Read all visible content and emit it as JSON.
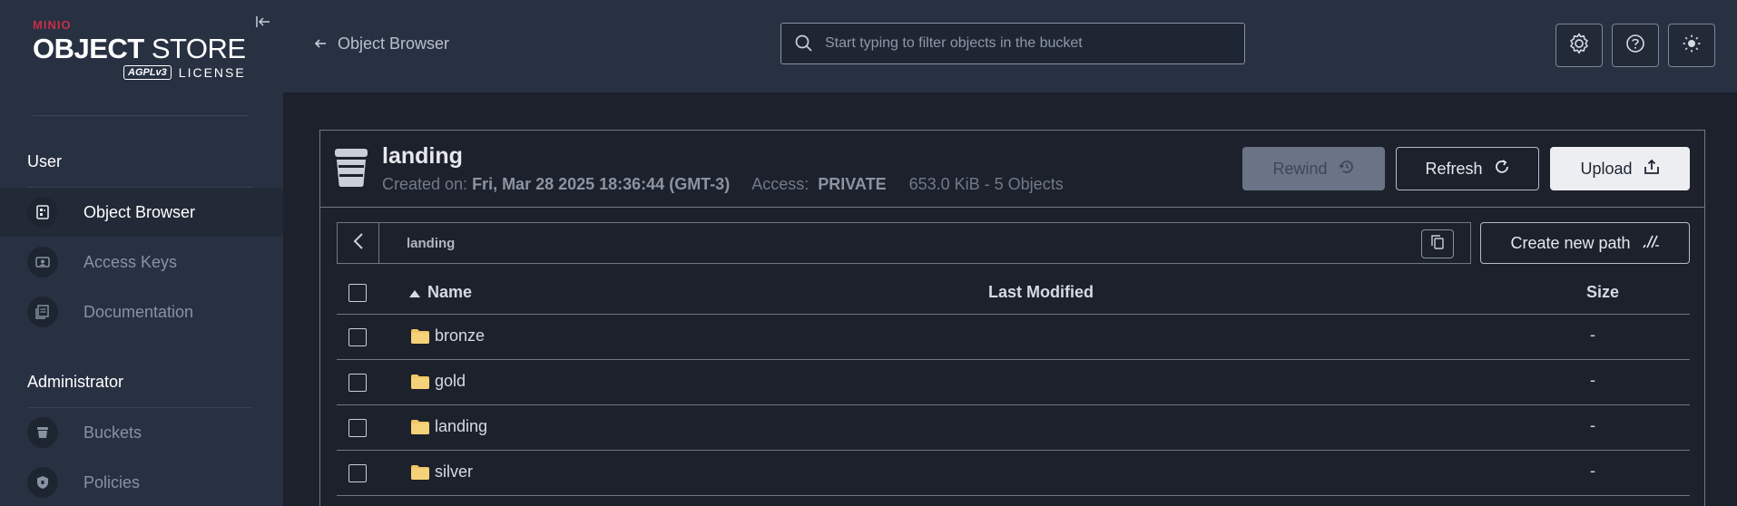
{
  "brand": {
    "minio": "MINIO",
    "store_bold": "OBJECT",
    "store_light": " STORE",
    "agpl": "AGPLv3",
    "license": "LICENSE"
  },
  "sidebar": {
    "sections": [
      {
        "title": "User"
      },
      {
        "title": "Administrator"
      }
    ],
    "items": [
      {
        "label": "Object Browser",
        "icon": "object-browser-icon"
      },
      {
        "label": "Access Keys",
        "icon": "access-keys-icon"
      },
      {
        "label": "Documentation",
        "icon": "documentation-icon"
      },
      {
        "label": "Buckets",
        "icon": "buckets-icon"
      },
      {
        "label": "Policies",
        "icon": "policies-icon"
      }
    ]
  },
  "header": {
    "back_label": "Object Browser",
    "search_placeholder": "Start typing to filter objects in the bucket"
  },
  "bucket": {
    "name": "landing",
    "created_label": "Created on: ",
    "created_value": "Fri, Mar 28 2025 18:36:44 (GMT-3)",
    "access_label": "Access: ",
    "access_value": "PRIVATE",
    "usage": "653.0 KiB - 5 Objects",
    "rewind_label": "Rewind",
    "refresh_label": "Refresh",
    "upload_label": "Upload"
  },
  "path": {
    "current": "landing",
    "create_new_path_label": "Create new path"
  },
  "table": {
    "columns": {
      "name": "Name",
      "modified": "Last Modified",
      "size": "Size"
    },
    "rows": [
      {
        "name": "bronze",
        "modified": "",
        "size": "-"
      },
      {
        "name": "gold",
        "modified": "",
        "size": "-"
      },
      {
        "name": "landing",
        "modified": "",
        "size": "-"
      },
      {
        "name": "silver",
        "modified": "",
        "size": "-"
      }
    ]
  },
  "colors": {
    "sidebar_bg": "#283142",
    "content_bg": "#1c212b",
    "accent_red": "#c72e49",
    "folder_yellow": "#f0c766"
  }
}
